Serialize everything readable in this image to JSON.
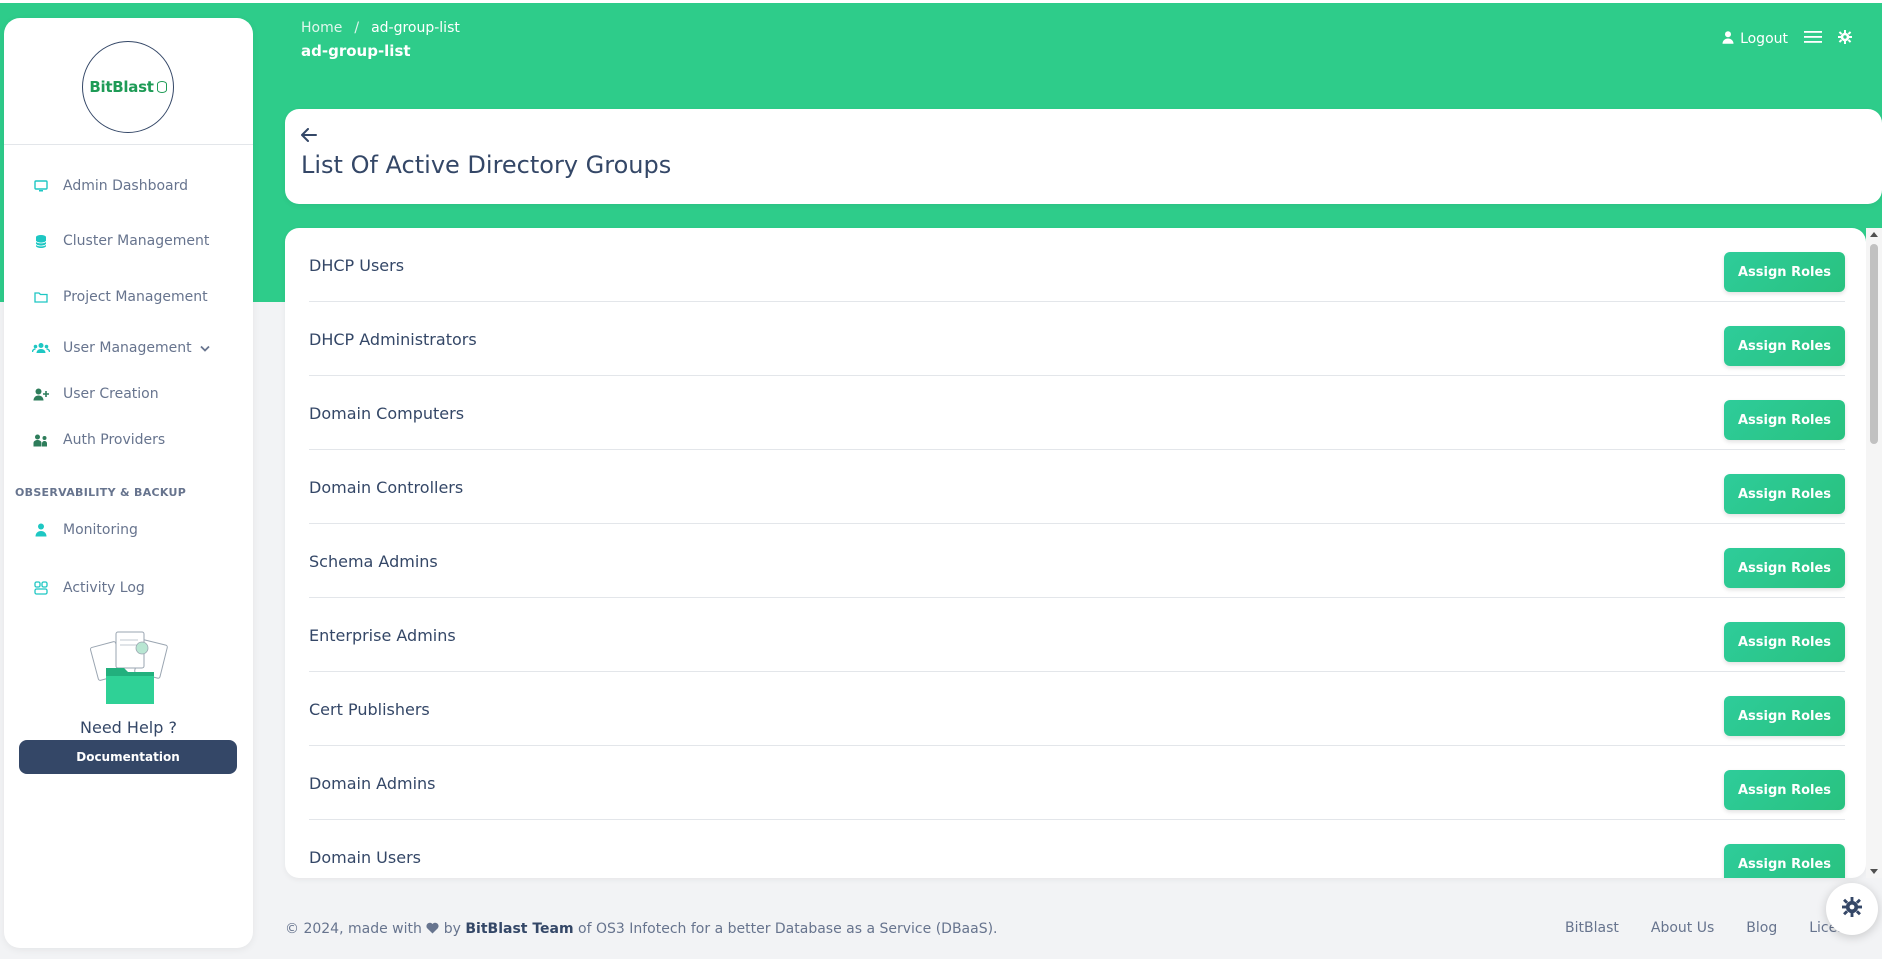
{
  "header": {
    "breadcrumb_home": "Home",
    "breadcrumb_sep": "/",
    "breadcrumb_current": "ad-group-list",
    "page_title": "ad-group-list",
    "logout_label": "Logout"
  },
  "sidebar": {
    "logo_text": "BitBlast",
    "items": [
      {
        "label": "Admin Dashboard",
        "icon": "monitor-icon"
      },
      {
        "label": "Cluster Management",
        "icon": "database-icon"
      },
      {
        "label": "Project Management",
        "icon": "folder-icon"
      },
      {
        "label": "User Management",
        "icon": "users-icon"
      },
      {
        "label": "User Creation",
        "icon": "user-plus-icon"
      },
      {
        "label": "Auth Providers",
        "icon": "user-group-icon"
      },
      {
        "label": "Monitoring",
        "icon": "user-icon"
      },
      {
        "label": "Activity Log",
        "icon": "activity-icon"
      }
    ],
    "section_label": "OBSERVABILITY & BACKUP",
    "help_title": "Need Help ?",
    "doc_button": "Documentation"
  },
  "main": {
    "card_title": "List Of Active Directory Groups",
    "assign_label": "Assign Roles",
    "groups": [
      "DHCP Users",
      "DHCP Administrators",
      "Domain Computers",
      "Domain Controllers",
      "Schema Admins",
      "Enterprise Admins",
      "Cert Publishers",
      "Domain Admins",
      "Domain Users"
    ]
  },
  "footer": {
    "copyright_prefix": "© 2024, made with",
    "by": "by",
    "team": "BitBlast Team",
    "suffix": "of OS3 Infotech for a better Database as a Service (DBaaS).",
    "links": [
      "BitBlast",
      "About Us",
      "Blog",
      "License"
    ]
  },
  "colors": {
    "brand_green": "#2ecc8a",
    "dark_navy": "#344767",
    "muted_text": "#67748e"
  }
}
